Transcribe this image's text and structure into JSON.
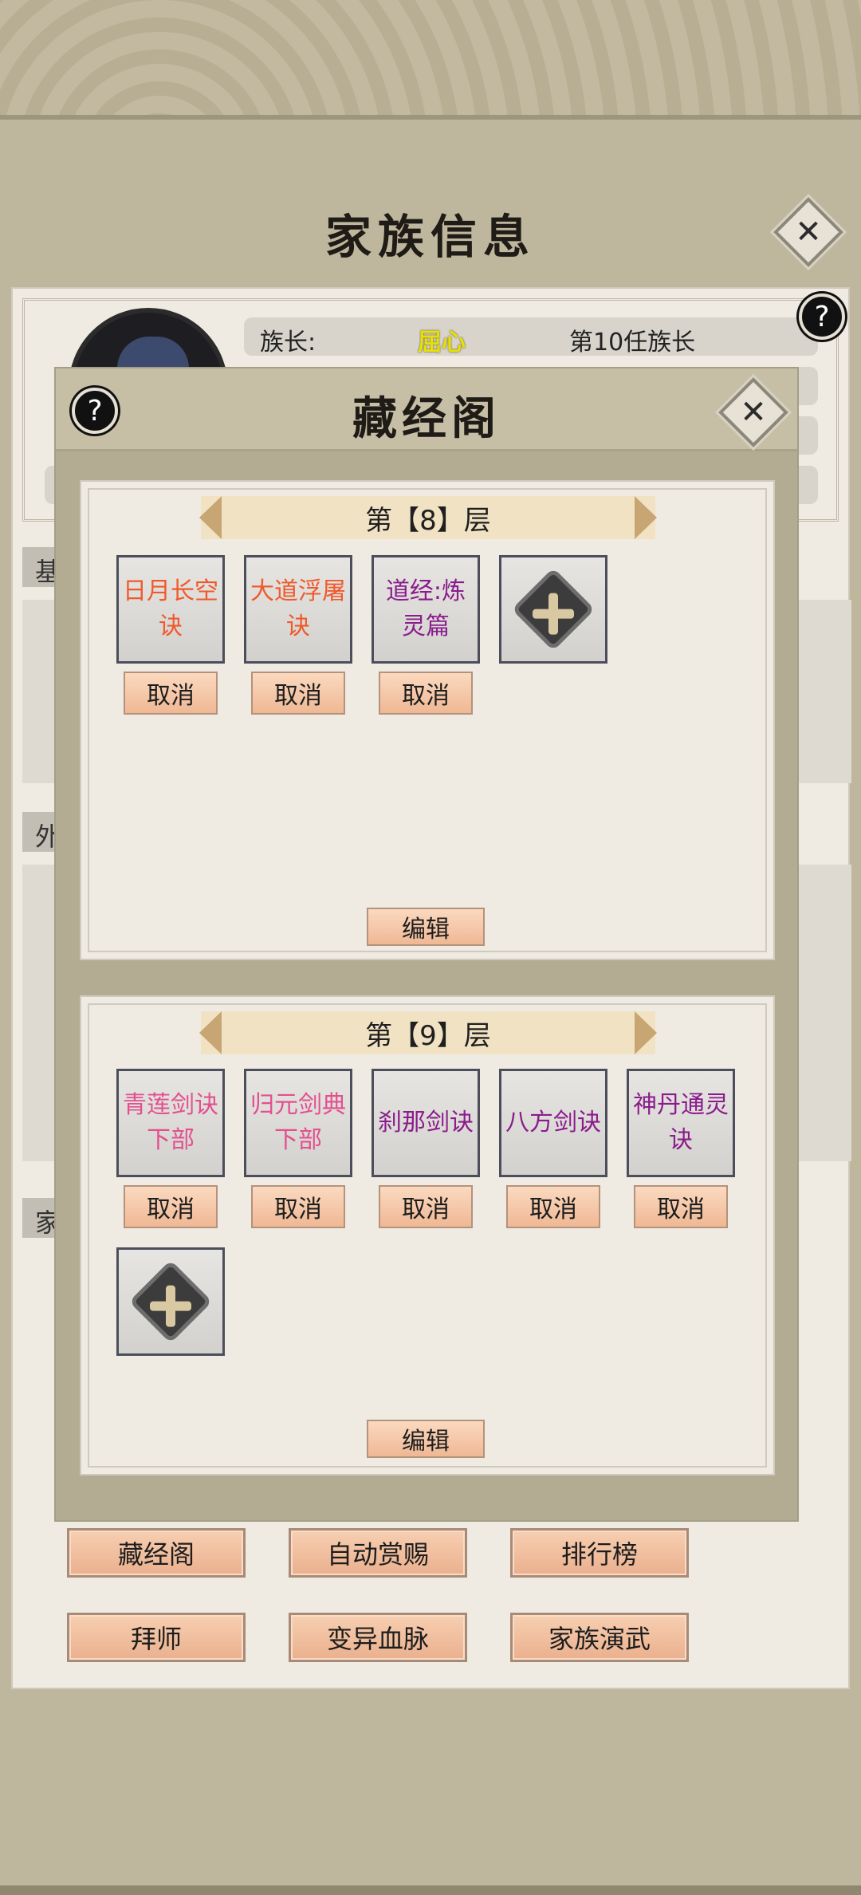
{
  "background": {
    "title": "家族信息",
    "leader_label": "族长:",
    "leader_name": "屈心",
    "leader_rank": "第10任族长",
    "side_tags": [
      "基",
      "外",
      "家"
    ],
    "buttons": [
      "藏经阁",
      "自动赏赐",
      "排行榜",
      "拜师",
      "变异血脉",
      "家族演武"
    ]
  },
  "modal": {
    "title": "藏经阁",
    "help_label": "?",
    "close_label": "✕",
    "cancel_label": "取消",
    "edit_label": "编辑",
    "layers": [
      {
        "label": "第【8】层",
        "books": [
          {
            "name": "日月长空诀",
            "color": "#ef5a2c"
          },
          {
            "name": "大道浮屠诀",
            "color": "#ef5a2c"
          },
          {
            "name": "道经:炼灵篇",
            "color": "#8a1c8c"
          }
        ]
      },
      {
        "label": "第【9】层",
        "books": [
          {
            "name": "青莲剑诀下部",
            "color": "#e2508f"
          },
          {
            "name": "归元剑典下部",
            "color": "#e2508f"
          },
          {
            "name": "刹那剑诀",
            "color": "#8a1c8c"
          },
          {
            "name": "八方剑诀",
            "color": "#8a1c8c"
          },
          {
            "name": "神丹通灵诀",
            "color": "#8a1c8c"
          }
        ]
      }
    ]
  },
  "icons": {
    "add": "add-book-icon",
    "help": "help-icon",
    "close": "close-icon"
  }
}
